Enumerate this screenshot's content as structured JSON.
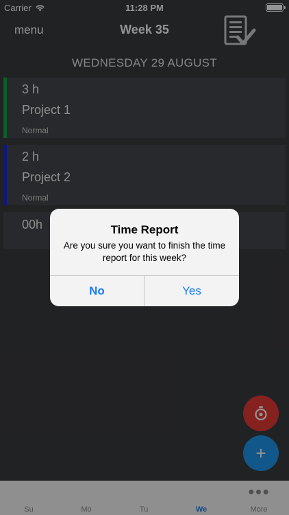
{
  "status_bar": {
    "carrier": "Carrier",
    "time": "11:28 PM",
    "wifi_icon": "wifi-icon",
    "battery_icon": "battery-icon"
  },
  "nav": {
    "menu_label": "menu",
    "title": "Week 35",
    "report_icon": "time-report-check-icon"
  },
  "date_header": "WEDNESDAY 29 AUGUST",
  "entries": [
    {
      "hours": "3 h",
      "project": "Project 1",
      "type": "Normal",
      "color": "#16a34a"
    },
    {
      "hours": "2 h",
      "project": "Project 2",
      "type": "Normal",
      "color": "#1e2ad8"
    },
    {
      "hours": "00h",
      "project": "",
      "type": "",
      "color": "#45474c"
    }
  ],
  "fabs": {
    "timer_icon": "stopwatch-icon",
    "timer_color": "#e53935",
    "add_label": "+",
    "add_color": "#1e96ee"
  },
  "tabs": [
    {
      "label": "Su",
      "active": false
    },
    {
      "label": "Mo",
      "active": false
    },
    {
      "label": "Tu",
      "active": false
    },
    {
      "label": "We",
      "active": true
    },
    {
      "label": "More",
      "active": false,
      "icon": "more-dots-icon"
    }
  ],
  "alert": {
    "title": "Time Report",
    "message": "Are you sure you want to finish the time report for this week?",
    "no_label": "No",
    "yes_label": "Yes"
  }
}
